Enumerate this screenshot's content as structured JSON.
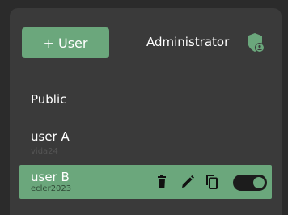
{
  "header": {
    "add_user_label": "+ User",
    "role_label": "Administrator",
    "role_icon": "admin-shield-icon"
  },
  "users": [
    {
      "name": "Public",
      "password": ""
    },
    {
      "name": "user A",
      "password": "vida24"
    },
    {
      "name": "user B",
      "password": "ecler2023",
      "selected": true,
      "enabled": true
    }
  ],
  "actions": {
    "delete_icon": "trash-icon",
    "edit_icon": "pencil-icon",
    "copy_icon": "copy-icon",
    "toggle": "toggle-switch"
  },
  "colors": {
    "background": "#2b2b2b",
    "panel": "#3a3a3a",
    "accent": "#6ba77c",
    "toggle_track": "#1c1c1c"
  }
}
